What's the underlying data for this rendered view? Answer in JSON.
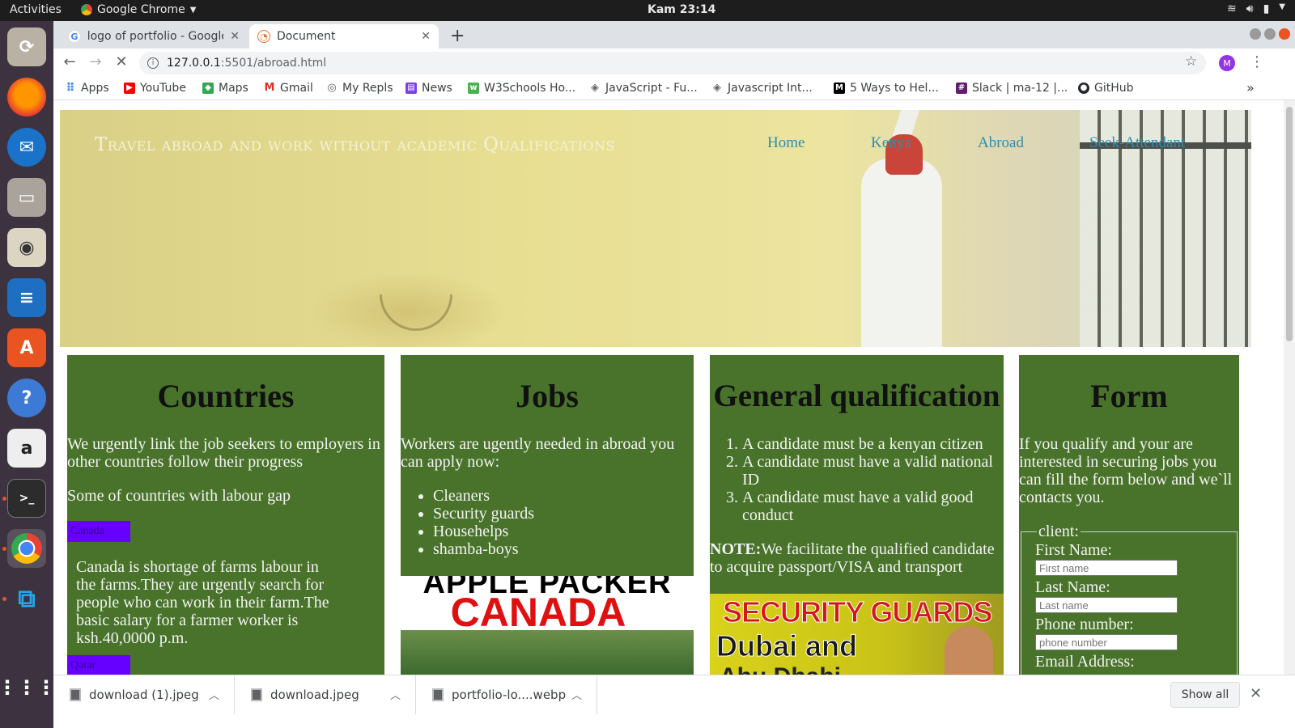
{
  "system": {
    "activities": "Activities",
    "app_name": "Google Chrome",
    "clock": "Kam 23:14"
  },
  "browser": {
    "tabs": [
      {
        "title": "logo of portfolio - Google",
        "active": false
      },
      {
        "title": "Document",
        "active": true
      }
    ],
    "url_host": "127.0.0.1",
    "url_rest": ":5501/abroad.html",
    "profile_initial": "M",
    "bookmarks": [
      {
        "label": "Apps",
        "icon": "apps-grid-icon",
        "color": "#4285f4"
      },
      {
        "label": "YouTube",
        "icon": "youtube-icon",
        "color": "#ff0000"
      },
      {
        "label": "Maps",
        "icon": "maps-icon",
        "color": "#34a853"
      },
      {
        "label": "Gmail",
        "icon": "gmail-icon",
        "color": "#d93025"
      },
      {
        "label": "My Repls",
        "icon": "replit-icon",
        "color": "#5f6368"
      },
      {
        "label": "News",
        "icon": "news-icon",
        "color": "#7b3fe4"
      },
      {
        "label": "W3Schools Ho...",
        "icon": "w3schools-icon",
        "color": "#4caf50"
      },
      {
        "label": "JavaScript - Fu...",
        "icon": "diamond-icon",
        "color": "#5f6368"
      },
      {
        "label": "Javascript Int...",
        "icon": "diamond-icon",
        "color": "#5f6368"
      },
      {
        "label": "5 Ways to Hel...",
        "icon": "medium-icon",
        "color": "#000000"
      },
      {
        "label": "Slack | ma-12 |...",
        "icon": "slack-icon",
        "color": "#611f69"
      },
      {
        "label": "GitHub",
        "icon": "github-icon",
        "color": "#24292e"
      }
    ]
  },
  "page": {
    "site_title": "Travel abroad and work without academic Qualifications",
    "nav": [
      "Home",
      "Kenya",
      "Abroad",
      "Seek-Attendant"
    ],
    "countries": {
      "heading": "Countries",
      "intro": "We urgently link the job seekers to employers in other countries follow their progress",
      "gap_text": "Some of countries with labour gap",
      "button1": "Canada",
      "canada_text": "Canada is shortage of farms labour in the farms.They are urgently search for people who can work in their farm.The basic salary for a farmer worker is ksh.40,0000 p.m.",
      "button2": "Qatar"
    },
    "jobs": {
      "heading": "Jobs",
      "intro": "Workers are ugently needed in abroad you can apply now:",
      "items": [
        "Cleaners",
        "Security guards",
        "Househelps",
        "shamba-boys"
      ],
      "image_line1": "APPLE PACKER",
      "image_line2": "CANADA"
    },
    "qualification": {
      "heading": "General qualification",
      "items": [
        "A candidate must be a kenyan citizen",
        "A candidate must have a valid national ID",
        "A candidate must have a valid good conduct"
      ],
      "note_label": "NOTE:",
      "note_text": "We facilitate the qualified candidate to acquire passport/VISA and transport",
      "image_line1": "SECURITY GUARDS",
      "image_line2": "Dubai and",
      "image_line3": "Abu Dhabi"
    },
    "form": {
      "heading": "Form",
      "intro": "If you qualify and your are interested in securing jobs you can fill the form below and we`ll contacts you.",
      "legend": "client:",
      "first_name_label": "First Name:",
      "first_name_placeholder": "First name",
      "last_name_label": "Last Name:",
      "last_name_placeholder": "Last name",
      "phone_label": "Phone number:",
      "phone_placeholder": "phone number",
      "email_label": "Email Address:"
    }
  },
  "downloads": {
    "files": [
      "download (1).jpeg",
      "download.jpeg",
      "portfolio-lo....webp"
    ],
    "show_all": "Show all"
  },
  "colors": {
    "column_bg": "#49732a",
    "country_button": "#6600ff",
    "nav_link": "#2c8fb0"
  }
}
